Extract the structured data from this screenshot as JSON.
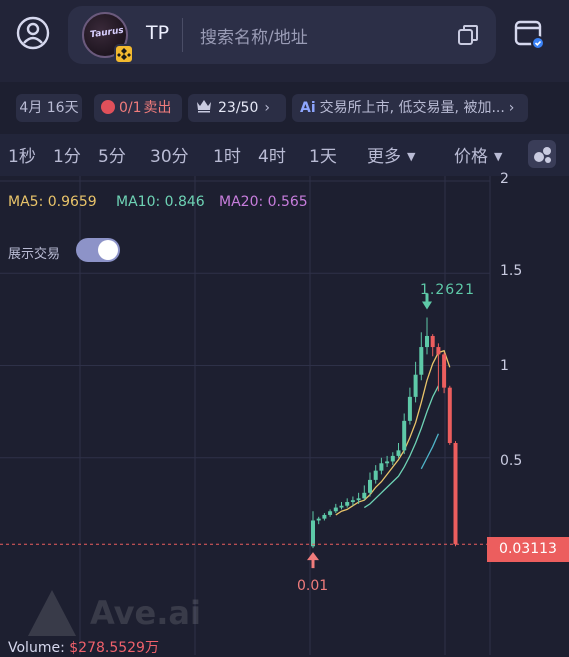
{
  "header": {
    "token_symbol": "TP",
    "logo_text": "Taurus",
    "search_placeholder": "搜索名称/地址"
  },
  "pills": {
    "date": "4月 16天",
    "sell_count": "0/1",
    "sell_label": "卖出",
    "holders": "23/50",
    "ai_prefix": "Ai",
    "ai_text": "交易所上市, 低交易量, 被加..."
  },
  "timeframes": [
    "1秒",
    "1分",
    "5分",
    "30分",
    "1时",
    "4时",
    "1天"
  ],
  "more_label": "更多",
  "price_label": "价格",
  "indicators": {
    "ma5": "MA5: 0.9659",
    "ma10": "MA10: 0.846",
    "ma20": "MA20: 0.565"
  },
  "toggle_label": "展示交易",
  "y_ticks": [
    "2",
    "1.5",
    "1",
    "0.5"
  ],
  "current_price": "0.03113",
  "high_label": "1.2621",
  "low_label": "0.01",
  "volume": {
    "label": "Volume: ",
    "value": "$278.5529万"
  },
  "watermark": "Ave.ai",
  "colors": {
    "up": "#5ec9a8",
    "down": "#ec5e5e",
    "ma5": "#e9c46a",
    "ma10": "#6ed3b5",
    "ma20": "#c77ddc"
  },
  "chart_data": {
    "type": "candlestick",
    "ylim": [
      0,
      2
    ],
    "y_ticks": [
      0.5,
      1,
      1.5,
      2
    ],
    "current_price": 0.03113,
    "candles": [
      {
        "o": 0.02,
        "h": 0.21,
        "l": 0.01,
        "c": 0.16
      },
      {
        "o": 0.16,
        "h": 0.18,
        "l": 0.14,
        "c": 0.17
      },
      {
        "o": 0.17,
        "h": 0.2,
        "l": 0.16,
        "c": 0.19
      },
      {
        "o": 0.19,
        "h": 0.22,
        "l": 0.18,
        "c": 0.21
      },
      {
        "o": 0.21,
        "h": 0.25,
        "l": 0.2,
        "c": 0.23
      },
      {
        "o": 0.23,
        "h": 0.26,
        "l": 0.22,
        "c": 0.24
      },
      {
        "o": 0.24,
        "h": 0.28,
        "l": 0.23,
        "c": 0.26
      },
      {
        "o": 0.26,
        "h": 0.29,
        "l": 0.24,
        "c": 0.27
      },
      {
        "o": 0.27,
        "h": 0.31,
        "l": 0.25,
        "c": 0.28
      },
      {
        "o": 0.28,
        "h": 0.35,
        "l": 0.27,
        "c": 0.31
      },
      {
        "o": 0.31,
        "h": 0.42,
        "l": 0.29,
        "c": 0.38
      },
      {
        "o": 0.38,
        "h": 0.46,
        "l": 0.36,
        "c": 0.43
      },
      {
        "o": 0.43,
        "h": 0.5,
        "l": 0.41,
        "c": 0.47
      },
      {
        "o": 0.47,
        "h": 0.51,
        "l": 0.45,
        "c": 0.48
      },
      {
        "o": 0.48,
        "h": 0.53,
        "l": 0.46,
        "c": 0.51
      },
      {
        "o": 0.51,
        "h": 0.58,
        "l": 0.5,
        "c": 0.54
      },
      {
        "o": 0.54,
        "h": 0.74,
        "l": 0.52,
        "c": 0.7
      },
      {
        "o": 0.7,
        "h": 0.88,
        "l": 0.68,
        "c": 0.83
      },
      {
        "o": 0.83,
        "h": 1.02,
        "l": 0.8,
        "c": 0.95
      },
      {
        "o": 0.95,
        "h": 1.18,
        "l": 0.92,
        "c": 1.1
      },
      {
        "o": 1.1,
        "h": 1.26,
        "l": 1.06,
        "c": 1.16
      },
      {
        "o": 1.16,
        "h": 1.17,
        "l": 1.05,
        "c": 1.1
      },
      {
        "o": 1.1,
        "h": 1.12,
        "l": 0.86,
        "c": 1.06
      },
      {
        "o": 1.06,
        "h": 1.07,
        "l": 0.85,
        "c": 0.88
      },
      {
        "o": 0.88,
        "h": 0.89,
        "l": 0.57,
        "c": 0.58
      },
      {
        "o": 0.58,
        "h": 0.59,
        "l": 0.02,
        "c": 0.03113
      }
    ],
    "ma5": [
      null,
      null,
      null,
      null,
      0.19,
      0.21,
      0.22,
      0.24,
      0.26,
      0.27,
      0.3,
      0.34,
      0.37,
      0.41,
      0.45,
      0.49,
      0.54,
      0.61,
      0.69,
      0.8,
      0.92,
      1.01,
      1.07,
      1.08,
      0.99
    ],
    "ma10": [
      null,
      null,
      null,
      null,
      null,
      null,
      null,
      null,
      null,
      0.23,
      0.25,
      0.28,
      0.31,
      0.34,
      0.37,
      0.4,
      0.45,
      0.51,
      0.58,
      0.66,
      0.75,
      0.83,
      0.89
    ],
    "ma20": [
      null,
      null,
      null,
      null,
      null,
      null,
      null,
      null,
      null,
      null,
      null,
      null,
      null,
      null,
      null,
      null,
      null,
      null,
      null,
      0.44,
      0.5,
      0.56,
      0.63
    ]
  }
}
